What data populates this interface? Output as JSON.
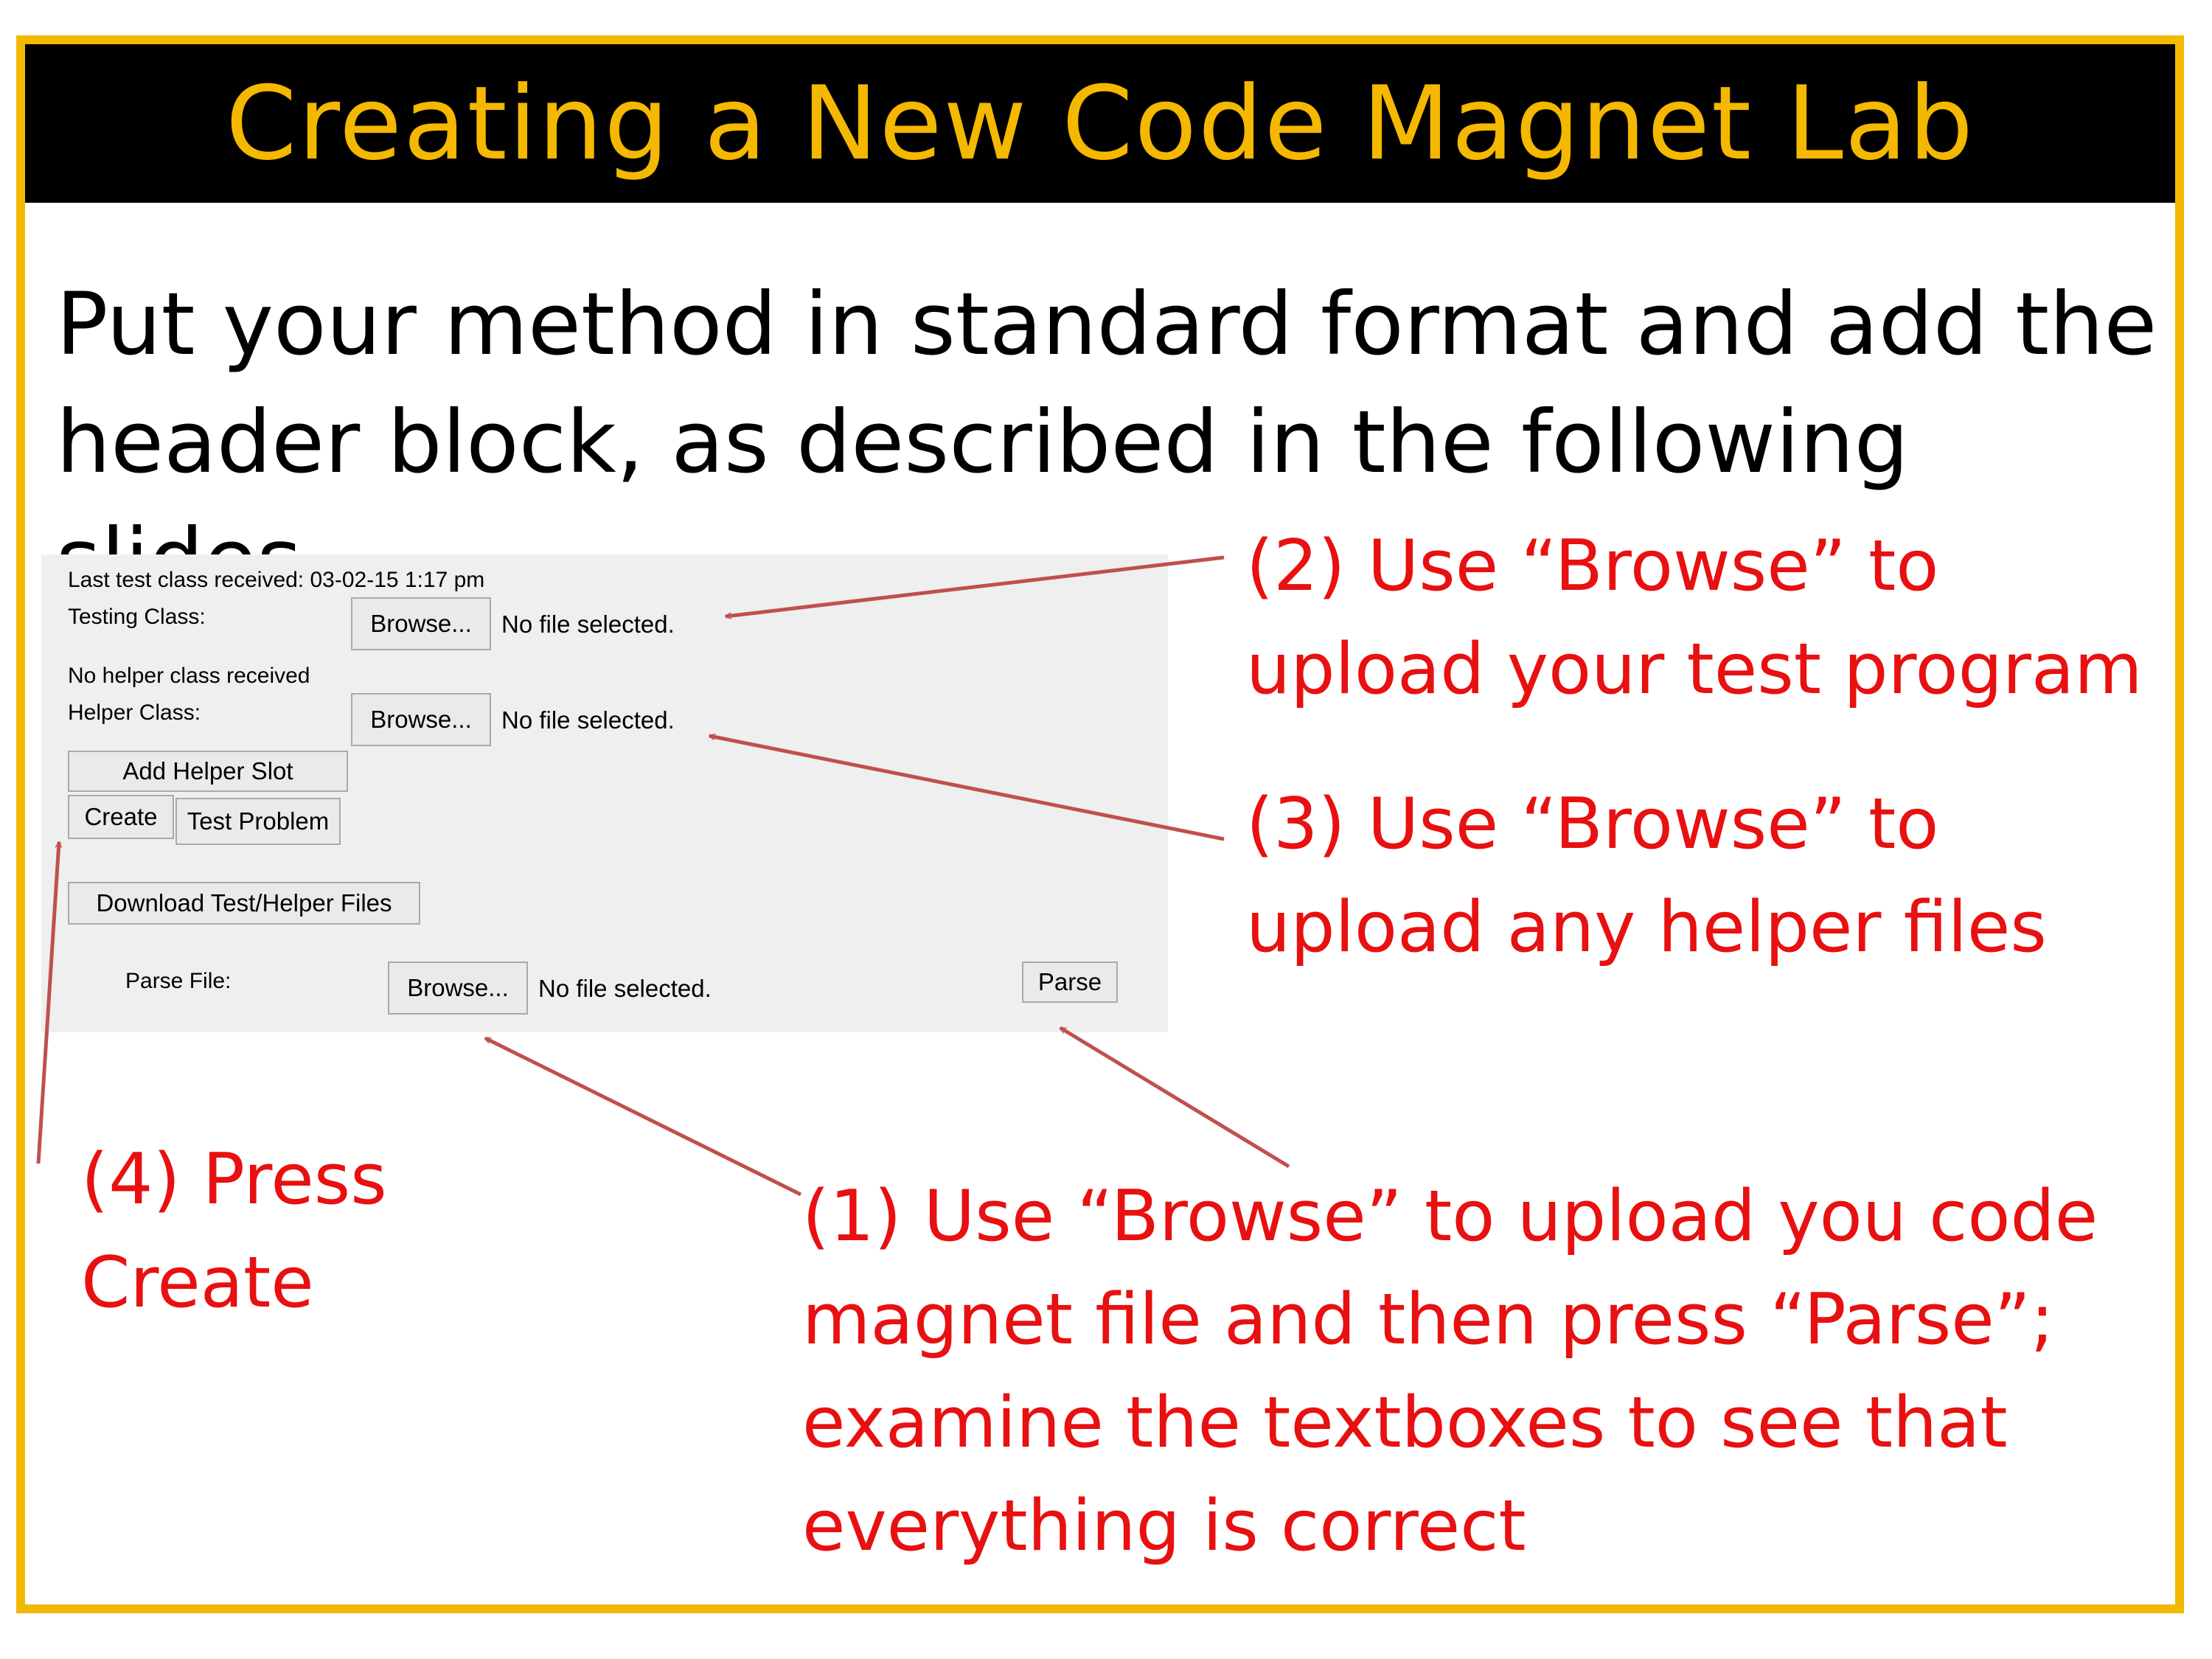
{
  "slide": {
    "title": "Creating a New Code Magnet Lab",
    "intro_line1": "Put your method in standard format and add the",
    "intro_line2": "header block, as described in the following slides"
  },
  "form": {
    "last_test_text": "Last test class received: 03-02-15 1:17 pm",
    "testing_label": "Testing Class:",
    "browse_label": "Browse...",
    "no_file_text": "No file selected.",
    "no_helper_text": "No helper class received",
    "helper_label": "Helper Class:",
    "add_helper_slot": "Add Helper Slot",
    "create": "Create",
    "test_problem": "Test Problem",
    "download_files": "Download Test/Helper Files",
    "parse_file_label": "Parse File:",
    "parse": "Parse"
  },
  "callouts": {
    "c2_line1": "(2) Use “Browse” to",
    "c2_line2": "upload your test program",
    "c3_line1": "(3) Use “Browse” to",
    "c3_line2": "upload any helper files",
    "c4_line1": "(4) Press",
    "c4_line2": "Create",
    "c1_line1": "(1) Use “Browse” to upload you code",
    "c1_line2": "magnet file and then press “Parse”;",
    "c1_line3": "examine the textboxes to see that",
    "c1_line4": "everything is correct"
  },
  "colors": {
    "frame": "#f3b800",
    "title_text": "#f5b800",
    "callout_text": "#e81010",
    "arrow": "#c0504d"
  }
}
